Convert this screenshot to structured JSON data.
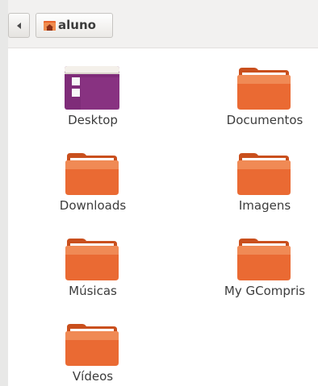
{
  "toolbar": {
    "current_folder": "aluno"
  },
  "items": [
    {
      "label": "Desktop",
      "icon": "desktop-icon"
    },
    {
      "label": "Documentos",
      "icon": "folder-icon"
    },
    {
      "label": "Downloads",
      "icon": "folder-icon"
    },
    {
      "label": "Imagens",
      "icon": "folder-icon"
    },
    {
      "label": "Músicas",
      "icon": "folder-icon"
    },
    {
      "label": "My GCompris",
      "icon": "folder-icon"
    },
    {
      "label": "Vídeos",
      "icon": "folder-icon"
    }
  ],
  "colors": {
    "folder_orange": "#e9622a",
    "desktop_purple": "#8a2e83",
    "toolbar_bg": "#f2f1f0"
  }
}
